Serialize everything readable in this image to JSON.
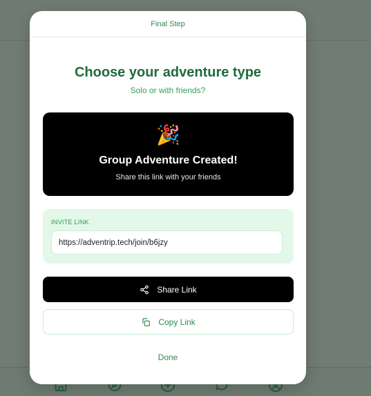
{
  "modal": {
    "step_label": "Final Step",
    "title": "Choose your adventure type",
    "subtitle": "Solo or with friends?",
    "success_card": {
      "emoji": "🎉",
      "emoji_icon": "party-popper-icon",
      "title": "Group Adventure Created!",
      "subtitle": "Share this link with your friends"
    },
    "invite": {
      "label": "INVITE LINK",
      "value": "https://adventrip.tech/join/b6jzy"
    },
    "share_button": {
      "label": "Share Link",
      "icon": "share-icon"
    },
    "copy_button": {
      "label": "Copy Link",
      "icon": "copy-icon"
    },
    "done_label": "Done"
  },
  "colors": {
    "accent_green": "#2e8b4d",
    "title_green": "#1f6a3c",
    "invite_bg": "#e3f8e8",
    "card_bg": "#000000"
  },
  "tabbar": {
    "icons": [
      "home-icon",
      "compass-icon",
      "add-circle-icon",
      "chat-icon",
      "profile-icon"
    ]
  }
}
